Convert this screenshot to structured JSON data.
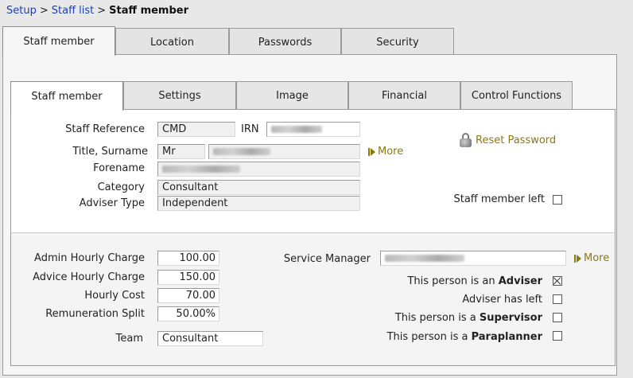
{
  "breadcrumb": {
    "setup": "Setup",
    "staff_list": "Staff list",
    "current": "Staff member",
    "separator": ">"
  },
  "main_tabs": [
    {
      "label": "Staff member",
      "active": true
    },
    {
      "label": "Location",
      "active": false
    },
    {
      "label": "Passwords",
      "active": false
    },
    {
      "label": "Security",
      "active": false
    }
  ],
  "sub_tabs": [
    {
      "label": "Staff member",
      "active": true
    },
    {
      "label": "Settings",
      "active": false
    },
    {
      "label": "Image",
      "active": false
    },
    {
      "label": "Financial",
      "active": false
    },
    {
      "label": "Control Functions",
      "active": false
    }
  ],
  "details": {
    "staff_reference_label": "Staff Reference",
    "staff_reference_value": "CMD",
    "irn_label": "IRN",
    "title_surname_label": "Title, Surname",
    "title_value": "Mr",
    "more_label": "More",
    "forename_label": "Forename",
    "category_label": "Category",
    "category_value": "Consultant",
    "adviser_type_label": "Adviser Type",
    "adviser_type_value": "Independent",
    "reset_password_label": "Reset Password",
    "staff_member_left_label": "Staff member left",
    "staff_member_left_checked": false
  },
  "charges": {
    "admin_hourly_label": "Admin Hourly Charge",
    "admin_hourly_value": "100.00",
    "advice_hourly_label": "Advice Hourly Charge",
    "advice_hourly_value": "150.00",
    "hourly_cost_label": "Hourly Cost",
    "hourly_cost_value": "70.00",
    "remuneration_split_label": "Remuneration Split",
    "remuneration_split_value": "50.00%",
    "team_label": "Team",
    "team_value": "Consultant",
    "service_manager_label": "Service Manager",
    "more_label": "More"
  },
  "roles": {
    "adviser_prefix": "This person is an",
    "adviser_bold": "Adviser",
    "adviser_checked": true,
    "adviser_left_label": "Adviser has left",
    "adviser_left_checked": false,
    "supervisor_prefix": "This person is a",
    "supervisor_bold": "Supervisor",
    "supervisor_checked": false,
    "paraplanner_prefix": "This person is a",
    "paraplanner_bold": "Paraplanner",
    "paraplanner_checked": false
  },
  "icons": {
    "reset_password": "lock-icon",
    "more": "more-arrow-icon"
  },
  "colors": {
    "link": "#1a3fb0",
    "action_link": "#8a7a10"
  }
}
